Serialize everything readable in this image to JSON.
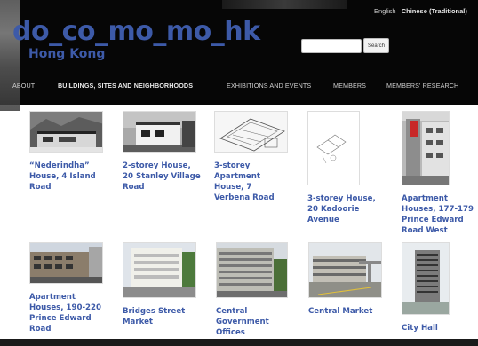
{
  "site": {
    "logo_main": "do_co_mo_mo_hk",
    "logo_sub": "Hong Kong"
  },
  "languages": {
    "current": "English",
    "alternate": "Chinese (Traditional)"
  },
  "search": {
    "placeholder": "",
    "button_label": "Search"
  },
  "nav": [
    {
      "label": "About",
      "active": false
    },
    {
      "label": "Buildings, Sites and Neighborhoods",
      "active": true
    },
    {
      "label": "Exhibitions and Events",
      "active": false
    },
    {
      "label": "Members",
      "active": false
    },
    {
      "label": "Members' Research",
      "active": false
    }
  ],
  "buildings": [
    {
      "name": "“Nederindha” House, 4 Island Road"
    },
    {
      "name": "2-storey House, 20 Stanley Village Road"
    },
    {
      "name": "3-storey Apartment House, 7 Verbena Road"
    },
    {
      "name": "3-storey House, 20 Kadoorie Avenue"
    },
    {
      "name": "Apartment Houses, 177-179 Prince Edward Road West"
    },
    {
      "name": "Apartment Houses, 190-220 Prince Edward Road"
    },
    {
      "name": "Bridges Street Market"
    },
    {
      "name": "Central Government Offices"
    },
    {
      "name": "Central Market"
    },
    {
      "name": "City Hall"
    }
  ]
}
